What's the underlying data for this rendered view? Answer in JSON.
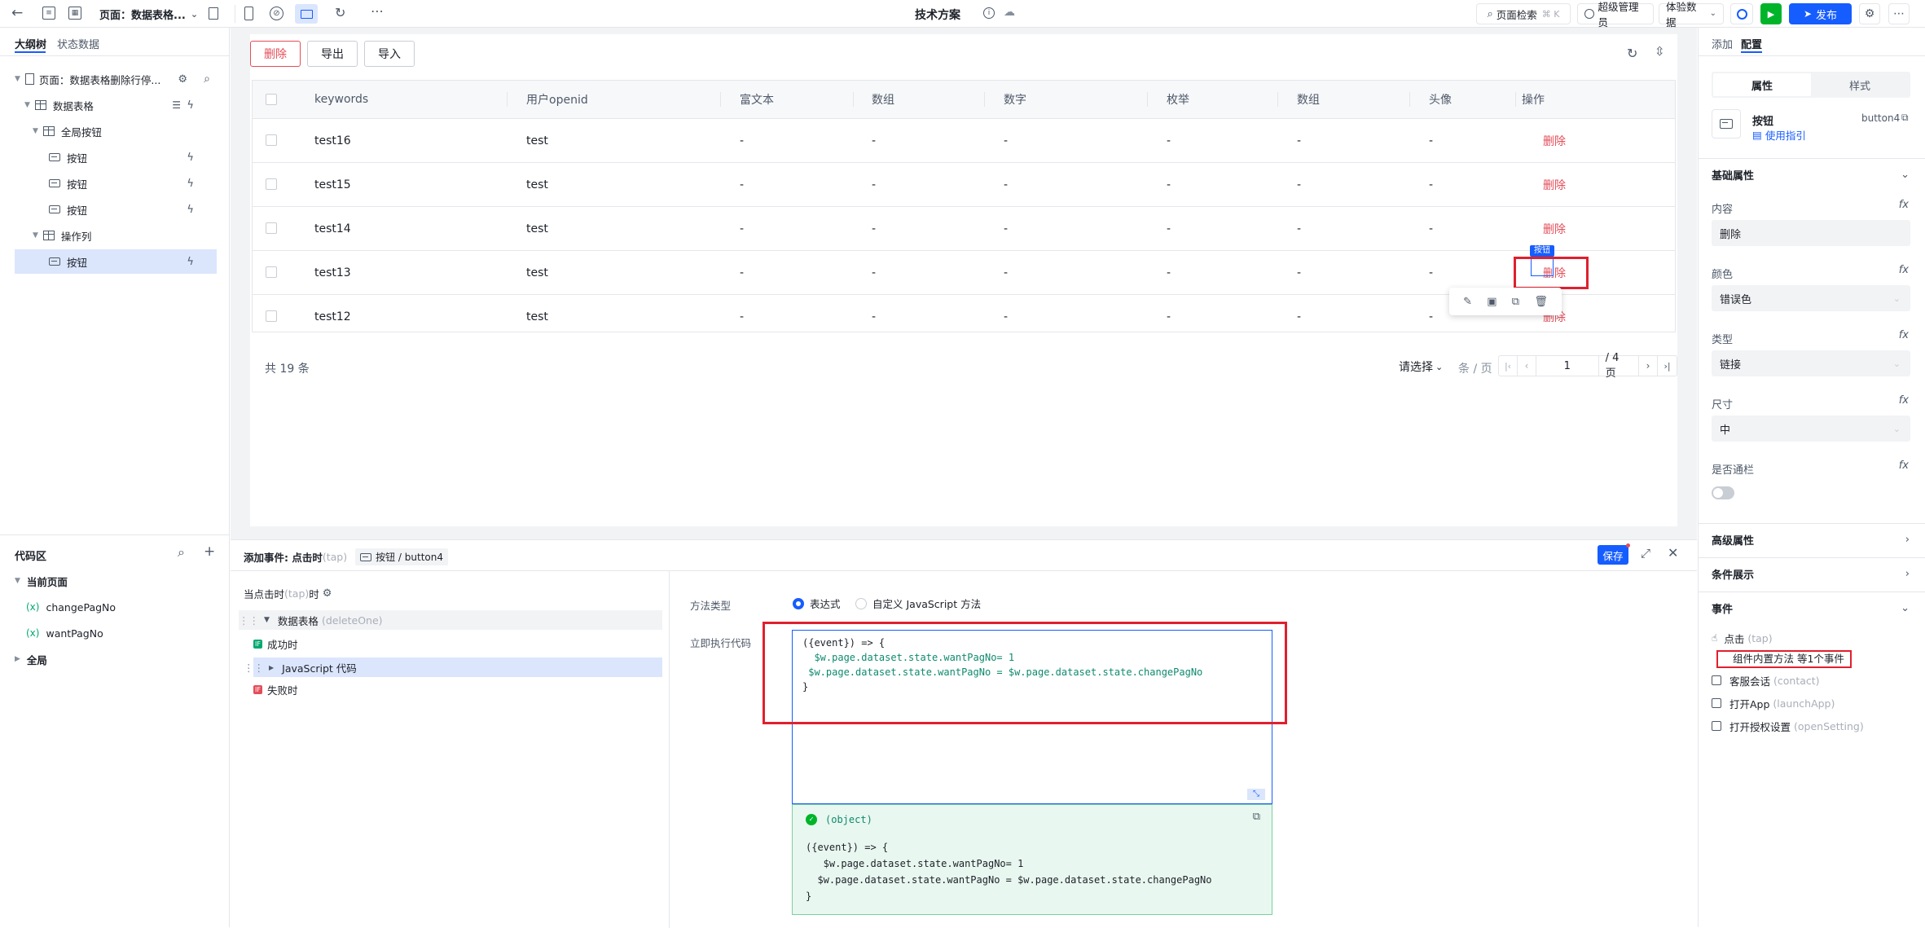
{
  "topbar": {
    "page_label": "页面：数据表格...",
    "center_title": "技术方案",
    "search_label": "页面检索",
    "search_shortcut": "⌘ K",
    "user_label": "超级管理员",
    "env_label": "体验数据",
    "publish_label": "发布"
  },
  "left": {
    "tab_outline": "大纲树",
    "tab_state": "状态数据",
    "tree": [
      {
        "label": "页面：数据表格删除行停..."
      },
      {
        "label": "数据表格"
      },
      {
        "label": "全局按钮"
      },
      {
        "label": "按钮"
      },
      {
        "label": "按钮"
      },
      {
        "label": "按钮"
      },
      {
        "label": "操作列"
      },
      {
        "label": "按钮"
      }
    ],
    "code_title": "代码区",
    "code_current": "当前页面",
    "code_vars": [
      "changePagNo",
      "wantPagNo"
    ],
    "code_global": "全局"
  },
  "canvas": {
    "btn_delete": "删除",
    "btn_export": "导出",
    "btn_import": "导入",
    "columns": [
      "keywords",
      "用户openid",
      "富文本",
      "数组",
      "数字",
      "枚举",
      "数组",
      "头像",
      "操作"
    ],
    "rows": [
      {
        "keywords": "test16",
        "openid": "test",
        "rich": "-",
        "arr": "-",
        "num": "-",
        "enum": "-",
        "arr2": "-",
        "avatar": "-",
        "op": "删除"
      },
      {
        "keywords": "test15",
        "openid": "test",
        "rich": "-",
        "arr": "-",
        "num": "-",
        "enum": "-",
        "arr2": "-",
        "avatar": "-",
        "op": "删除"
      },
      {
        "keywords": "test14",
        "openid": "test",
        "rich": "-",
        "arr": "-",
        "num": "-",
        "enum": "-",
        "arr2": "-",
        "avatar": "-",
        "op": "删除"
      },
      {
        "keywords": "test13",
        "openid": "test",
        "rich": "-",
        "arr": "-",
        "num": "-",
        "enum": "-",
        "arr2": "-",
        "avatar": "-",
        "op": "删除"
      },
      {
        "keywords": "test12",
        "openid": "test",
        "rich": "-",
        "arr": "-",
        "num": "-",
        "enum": "-",
        "arr2": "-",
        "avatar": "-",
        "op": "删除"
      }
    ],
    "selected_badge": "按钮",
    "total": "共 19 条",
    "page_size_placeholder": "请选择",
    "per_page": "条 / 页",
    "current_page": "1",
    "total_pages": "/ 4 页"
  },
  "event_panel": {
    "title_prefix": "添加事件: 点击时",
    "title_event": "(tap)",
    "breadcrumb": "按钮 / button4",
    "save_label": "保存",
    "trigger_label": "当点击时",
    "trigger_event": "(tap)",
    "trigger_suffix": "时",
    "action_label": "数据表格",
    "action_method": "(deleteOne)",
    "success_label": "成功时",
    "js_label": "JavaScript 代码",
    "fail_label": "失败时",
    "if_badge": "IF",
    "method_type_label": "方法类型",
    "radio_expr": "表达式",
    "radio_custom": "自定义 JavaScript 方法",
    "exec_label": "立即执行代码",
    "code_lines": [
      "({event}) => {",
      "  $w.page.dataset.state.wantPagNo= 1",
      " $w.page.dataset.state.wantPagNo = $w.page.dataset.state.changePagNo",
      "}"
    ],
    "result_type": "(object)",
    "result_lines": [
      "({event}) => {",
      "   $w.page.dataset.state.wantPagNo= 1",
      "  $w.page.dataset.state.wantPagNo = $w.page.dataset.state.changePagNo",
      "}"
    ]
  },
  "right": {
    "tab_add": "添加",
    "tab_config": "配置",
    "seg_props": "属性",
    "seg_style": "样式",
    "comp_name": "按钮",
    "comp_id": "button4",
    "usage_link": "使用指引",
    "basic_section": "基础属性",
    "content_label": "内容",
    "content_value": "删除",
    "color_label": "颜色",
    "color_value": "错误色",
    "type_label": "类型",
    "type_value": "链接",
    "size_label": "尺寸",
    "size_value": "中",
    "block_label": "是否通栏",
    "advanced_section": "高级属性",
    "condition_section": "条件展示",
    "events_section": "事件",
    "events": [
      {
        "label": "点击",
        "event": "(tap)"
      },
      {
        "label": "组件内置方法 等1个事件",
        "event": ""
      },
      {
        "label": "客服会话",
        "event": "(contact)"
      },
      {
        "label": "打开App",
        "event": "(launchApp)"
      },
      {
        "label": "打开授权设置",
        "event": "(openSetting)"
      }
    ]
  },
  "colors": {
    "primary": "#165dff",
    "danger": "#e34d59",
    "highlight_red": "#e0202e",
    "success": "#00b42a",
    "selected_bg": "#dbe6fd"
  }
}
